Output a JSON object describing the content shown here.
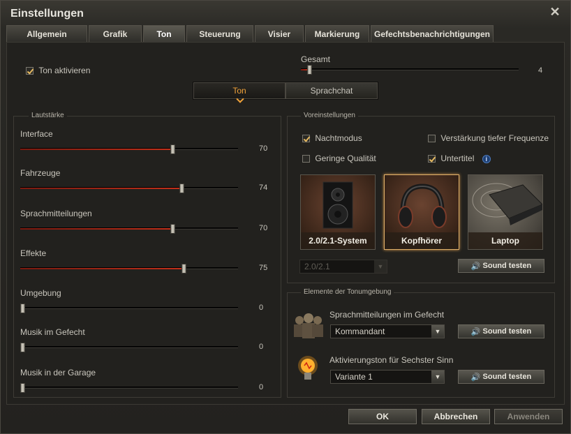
{
  "window": {
    "title": "Einstellungen"
  },
  "tabs": [
    {
      "label": "Allgemein"
    },
    {
      "label": "Grafik"
    },
    {
      "label": "Ton"
    },
    {
      "label": "Steuerung"
    },
    {
      "label": "Visier"
    },
    {
      "label": "Markierung"
    },
    {
      "label": "Gefechtsbenachrichtigungen"
    }
  ],
  "top": {
    "enable_sound_label": "Ton aktivieren",
    "enable_sound_checked": true,
    "master_label": "Gesamt",
    "master_value": "4",
    "master_level": 0.04
  },
  "segment": {
    "left": "Ton",
    "right": "Sprachchat"
  },
  "volume": {
    "title": "Lautstärke",
    "sliders": [
      {
        "label": "Interface",
        "value": "70",
        "level": 0.7
      },
      {
        "label": "Fahrzeuge",
        "value": "74",
        "level": 0.74
      },
      {
        "label": "Sprachmitteilungen",
        "value": "70",
        "level": 0.7
      },
      {
        "label": "Effekte",
        "value": "75",
        "level": 0.75
      },
      {
        "label": "Umgebung",
        "value": "0",
        "level": 0
      },
      {
        "label": "Musik im Gefecht",
        "value": "0",
        "level": 0
      },
      {
        "label": "Musik in der Garage",
        "value": "0",
        "level": 0
      }
    ]
  },
  "presets": {
    "title": "Voreinstellungen",
    "options": [
      {
        "label": "Nachtmodus",
        "checked": true
      },
      {
        "label": "Verstärkung tiefer Frequenze",
        "checked": false
      },
      {
        "label": "Geringe Qualität",
        "checked": false
      },
      {
        "label": "Untertitel",
        "checked": true
      }
    ],
    "devices": [
      {
        "label": "2.0/2.1-System",
        "icon": "speaker-icon",
        "active": false
      },
      {
        "label": "Kopfhörer",
        "icon": "headphones-icon",
        "active": true
      },
      {
        "label": "Laptop",
        "icon": "laptop-icon",
        "active": false
      }
    ],
    "system_select": "2.0/2.1",
    "test_label": "Sound testen"
  },
  "environment": {
    "title": "Elemente der Tonumgebung",
    "voice_label": "Sprachmitteilungen im Gefecht",
    "voice_value": "Kommandant",
    "sixth_label": "Aktivierungston für Sechster Sinn",
    "sixth_value": "Variante 1",
    "test_label": "Sound testen"
  },
  "footer": {
    "ok": "OK",
    "cancel": "Abbrechen",
    "apply": "Anwenden"
  },
  "colors": {
    "accent": "#f0a23a",
    "slider_fill": "#c2301a"
  }
}
